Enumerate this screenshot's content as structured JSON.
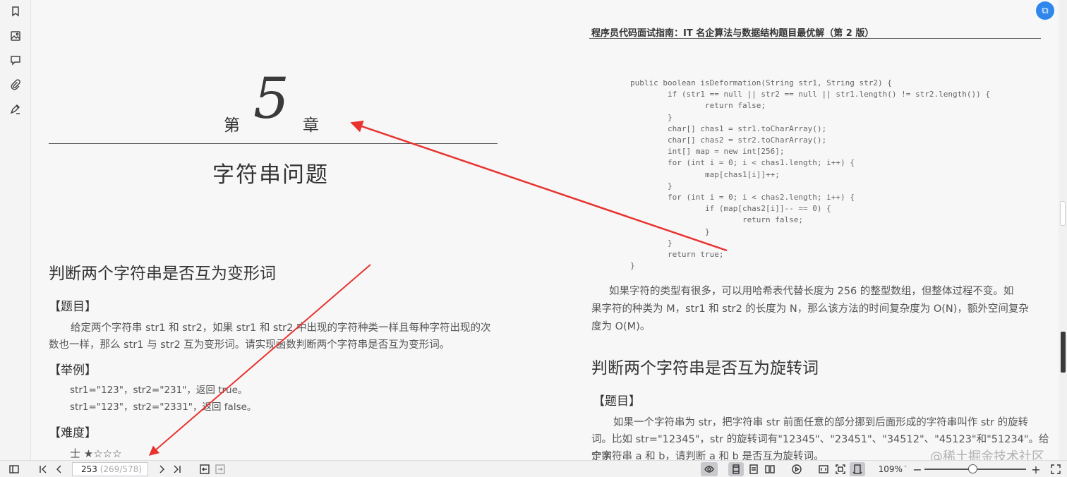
{
  "toolbar_left": {
    "icons": [
      "bookmark-icon",
      "image-icon",
      "comment-icon",
      "paperclip-icon",
      "sign-icon"
    ]
  },
  "left_page": {
    "chapter_prefix": "第",
    "chapter_number": "5",
    "chapter_suffix": "章",
    "chapter_title": "字符串问题",
    "section_title": "判断两个字符串是否互为变形词",
    "topic_heading": "【题目】",
    "topic_line1": "给定两个字符串 str1 和 str2，如果 str1 和 str2 中出现的字符种类一样且每种字符出现的次",
    "topic_line2": "数也一样，那么 str1 与 str2 互为变形词。请实现函数判断两个字符串是否互为变形词。",
    "example_heading": "【举例】",
    "example1": "str1=\"123\"，str2=\"231\"，返回 true。",
    "example2": "str1=\"123\"，str2=\"2331\"，返回 false。",
    "difficulty_heading": "【难度】",
    "difficulty_value": "士 ★☆☆☆"
  },
  "right_page": {
    "running_head": "程序员代码面试指南：IT 名企算法与数据结构题目最优解（第 2 版）",
    "code_lines": [
      "public boolean isDeformation(String str1, String str2) {",
      "        if (str1 == null || str2 == null || str1.length() != str2.length()) {",
      "                return false;",
      "        }",
      "        char[] chas1 = str1.toCharArray();",
      "        char[] chas2 = str2.toCharArray();",
      "        int[] map = new int[256];",
      "        for (int i = 0; i < chas1.length; i++) {",
      "                map[chas1[i]]++;",
      "        }",
      "        for (int i = 0; i < chas2.length; i++) {",
      "                if (map[chas2[i]]-- == 0) {",
      "                        return false;",
      "                }",
      "        }",
      "        return true;",
      "}"
    ],
    "para1_line1": "如果字符的类型有很多，可以用哈希表代替长度为 256 的整型数组，但整体过程不变。如",
    "para1_line2": "果字符的种类为 M，str1 和 str2 的长度为 N，那么该方法的时间复杂度为 O(N)，额外空间复杂",
    "para1_line3": "度为 O(M)。",
    "section2_title": "判断两个字符串是否互为旋转词",
    "topic2_heading": "【题目】",
    "topic2_line1": "如果一个字符串为 str，把字符串 str 前面任意的部分挪到后面形成的字符串叫作 str 的旋转",
    "topic2_line2": "词。比如 str=\"12345\"，str 的旋转词有\"12345\"、\"23451\"、\"34512\"、\"45123\"和\"51234\"。给定两",
    "topic2_line3": "个字符串 a 和 b，请判断 a 和 b 是否互为旋转词。"
  },
  "bottom_bar": {
    "current_page": "253",
    "page_total": "(269/578)",
    "zoom": "109%",
    "zoom_fraction": 0.47
  },
  "watermark": "@稀土掘金技术社区",
  "colors": {
    "arrow": "#e8332f",
    "accent": "#2f86eb"
  }
}
